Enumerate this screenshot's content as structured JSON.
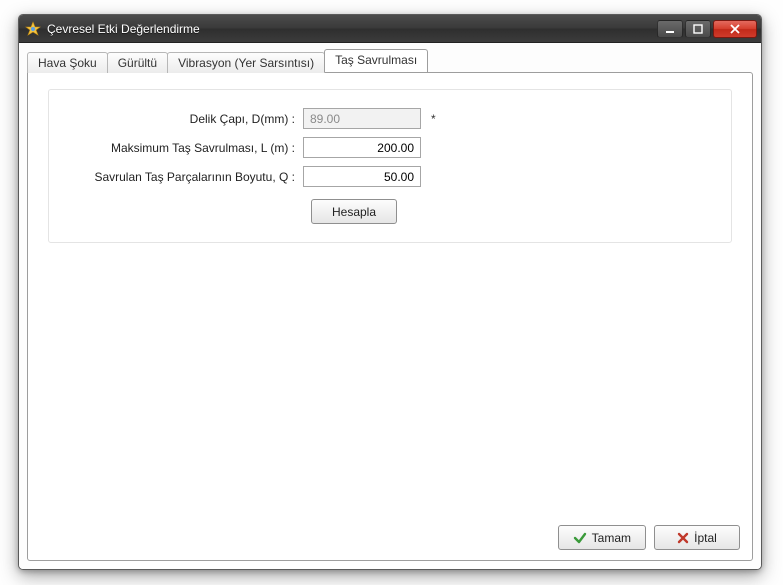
{
  "window": {
    "title": "Çevresel Etki Değerlendirme"
  },
  "tabs": [
    {
      "label": "Hava Şoku",
      "active": false
    },
    {
      "label": "Gürültü",
      "active": false
    },
    {
      "label": "Vibrasyon (Yer Sarsıntısı)",
      "active": false
    },
    {
      "label": "Taş Savrulması",
      "active": true
    }
  ],
  "form": {
    "hole_diameter_label": "Delik Çapı, D(mm) :",
    "hole_diameter_value": "89.00",
    "hole_diameter_required_mark": "*",
    "max_flyrock_label": "Maksimum Taş Savrulması, L (m) :",
    "max_flyrock_value": "200.00",
    "fragment_size_label": "Savrulan Taş Parçalarının Boyutu, Q :",
    "fragment_size_value": "50.00",
    "calculate_label": "Hesapla"
  },
  "footer": {
    "ok_label": "Tamam",
    "cancel_label": "İptal"
  },
  "icons": {
    "app": "star-icon",
    "minimize": "minimize-icon",
    "maximize": "maximize-icon",
    "close": "close-icon",
    "ok": "check-icon",
    "cancel": "cross-icon"
  }
}
